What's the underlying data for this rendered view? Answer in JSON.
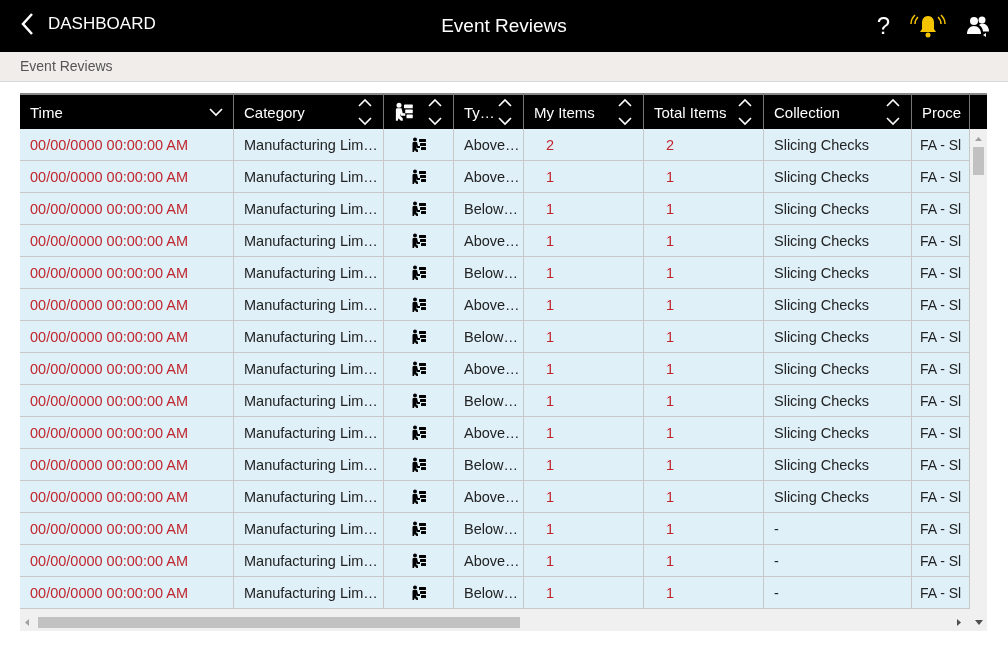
{
  "header": {
    "back_label": "DASHBOARD",
    "title": "Event Reviews",
    "help_label": "?",
    "alarm_active": true
  },
  "breadcrumb": "Event Reviews",
  "table": {
    "columns": [
      {
        "kind": "text",
        "label": "Time",
        "sorted": true,
        "emphasis": true
      },
      {
        "kind": "text",
        "label": "Category",
        "sorted": false,
        "emphasis": false
      },
      {
        "kind": "icon",
        "sorted": false
      },
      {
        "kind": "text",
        "label": "Ty…",
        "sorted": false,
        "emphasis": false
      },
      {
        "kind": "text",
        "label": "My Items",
        "sorted": false,
        "emphasis": true
      },
      {
        "kind": "text",
        "label": "Total Items",
        "sorted": false,
        "emphasis": true
      },
      {
        "kind": "text",
        "label": "Collection",
        "sorted": false,
        "emphasis": false
      },
      {
        "kind": "text",
        "label": "Proce",
        "emphasis": false
      }
    ],
    "rows": [
      {
        "cells": [
          "00/00/0000 00:00:00 AM",
          "Manufacturing Lim…",
          "",
          "Above…",
          "2",
          "2",
          "Slicing Checks",
          "FA - Sl"
        ]
      },
      {
        "cells": [
          "00/00/0000 00:00:00 AM",
          "Manufacturing Lim…",
          "",
          "Above…",
          "1",
          "1",
          "Slicing Checks",
          "FA - Sl"
        ]
      },
      {
        "cells": [
          "00/00/0000 00:00:00 AM",
          "Manufacturing Lim…",
          "",
          "Below…",
          "1",
          "1",
          "Slicing Checks",
          "FA - Sl"
        ]
      },
      {
        "cells": [
          "00/00/0000 00:00:00 AM",
          "Manufacturing Lim…",
          "",
          "Above…",
          "1",
          "1",
          "Slicing Checks",
          "FA - Sl"
        ]
      },
      {
        "cells": [
          "00/00/0000 00:00:00 AM",
          "Manufacturing Lim…",
          "",
          "Below…",
          "1",
          "1",
          "Slicing Checks",
          "FA - Sl"
        ]
      },
      {
        "cells": [
          "00/00/0000 00:00:00 AM",
          "Manufacturing Lim…",
          "",
          "Above…",
          "1",
          "1",
          "Slicing Checks",
          "FA - Sl"
        ]
      },
      {
        "cells": [
          "00/00/0000 00:00:00 AM",
          "Manufacturing Lim…",
          "",
          "Below…",
          "1",
          "1",
          "Slicing Checks",
          "FA - Sl"
        ]
      },
      {
        "cells": [
          "00/00/0000 00:00:00 AM",
          "Manufacturing Lim…",
          "",
          "Above…",
          "1",
          "1",
          "Slicing Checks",
          "FA - Sl"
        ]
      },
      {
        "cells": [
          "00/00/0000 00:00:00 AM",
          "Manufacturing Lim…",
          "",
          "Below…",
          "1",
          "1",
          "Slicing Checks",
          "FA - Sl"
        ]
      },
      {
        "cells": [
          "00/00/0000 00:00:00 AM",
          "Manufacturing Lim…",
          "",
          "Above…",
          "1",
          "1",
          "Slicing Checks",
          "FA - Sl"
        ]
      },
      {
        "cells": [
          "00/00/0000 00:00:00 AM",
          "Manufacturing Lim…",
          "",
          "Below…",
          "1",
          "1",
          "Slicing Checks",
          "FA - Sl"
        ]
      },
      {
        "cells": [
          "00/00/0000 00:00:00 AM",
          "Manufacturing Lim…",
          "",
          "Above…",
          "1",
          "1",
          "Slicing Checks",
          "FA - Sl"
        ]
      },
      {
        "cells": [
          "00/00/0000 00:00:00 AM",
          "Manufacturing Lim…",
          "",
          "Below…",
          "1",
          "1",
          "-",
          "FA - Sl"
        ]
      },
      {
        "cells": [
          "00/00/0000 00:00:00 AM",
          "Manufacturing Lim…",
          "",
          "Above…",
          "1",
          "1",
          "-",
          "FA - Sl"
        ]
      },
      {
        "cells": [
          "00/00/0000 00:00:00 AM",
          "Manufacturing Lim…",
          "",
          "Below…",
          "1",
          "1",
          "-",
          "FA - Sl"
        ]
      }
    ]
  }
}
